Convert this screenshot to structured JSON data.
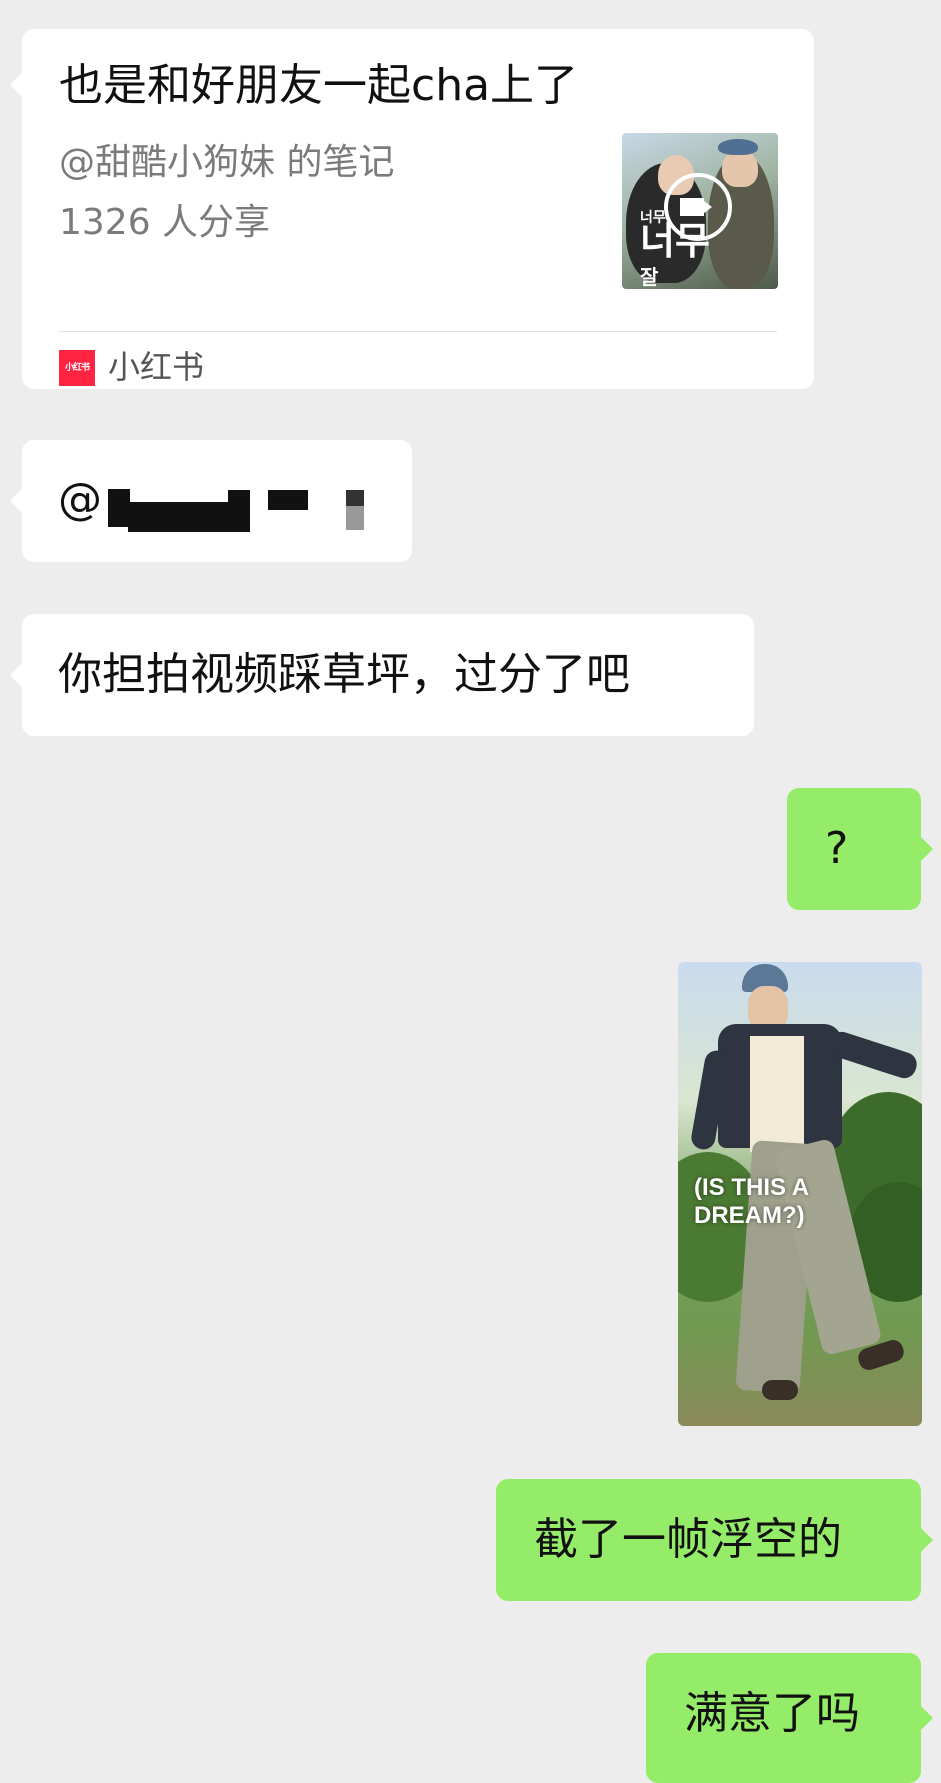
{
  "shared_card": {
    "title": "也是和好朋友一起cha上了",
    "author_line": "@甜酷小狗妹 的笔记",
    "share_count": "1326 人分享",
    "thumbnail_text_top": "너무",
    "thumbnail_text_big": "너무",
    "thumbnail_text_bottom": "잘",
    "app_logo_text": "小红书",
    "app_name": "小红书"
  },
  "messages": [
    {
      "side": "left",
      "text": "@"
    },
    {
      "side": "left",
      "text": "你担拍视频踩草坪，过分了吧"
    },
    {
      "side": "right",
      "text": "?"
    },
    {
      "side": "right",
      "type": "image",
      "caption": "(IS THIS A\nDREAM?)"
    },
    {
      "side": "right",
      "text": "截了一帧浮空的"
    },
    {
      "side": "right",
      "text": "满意了吗"
    }
  ],
  "colors": {
    "background": "#ededed",
    "incoming_bubble": "#ffffff",
    "outgoing_bubble": "#95ec69",
    "xiaohongshu_red": "#ff2442"
  }
}
